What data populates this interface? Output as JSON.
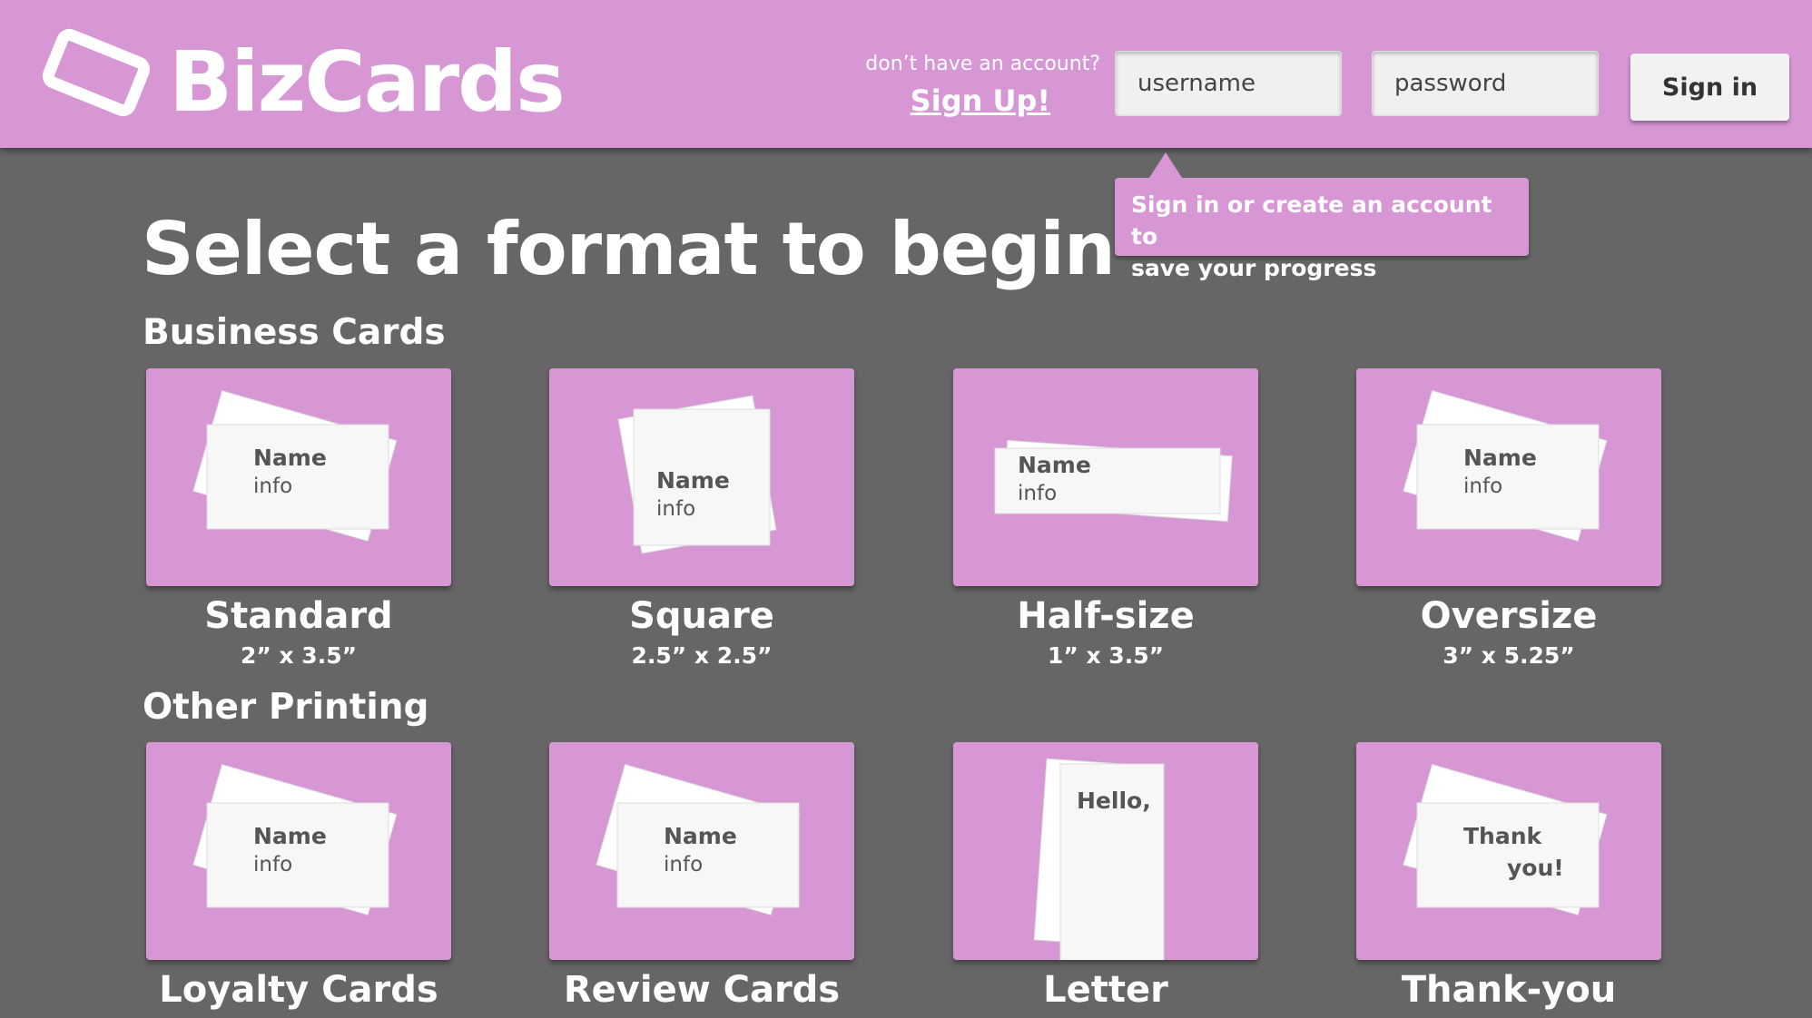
{
  "header": {
    "brand": "BizCards",
    "signup_prompt": "don’t have an account?",
    "signup_link": "Sign Up!",
    "username_placeholder": "username",
    "password_placeholder": "password",
    "signin_label": "Sign in"
  },
  "tooltip": {
    "line1": "Sign in or create an account to",
    "line2": "save your progress"
  },
  "page_title": "Select a format to begin",
  "sections": [
    {
      "heading": "Business Cards",
      "items": [
        {
          "label": "Standard",
          "size": "2” x 3.5”",
          "card_title": "Name",
          "card_sub": "info"
        },
        {
          "label": "Square",
          "size": "2.5” x 2.5”",
          "card_title": "Name",
          "card_sub": "info"
        },
        {
          "label": "Half-size",
          "size": "1” x 3.5”",
          "card_title": "Name",
          "card_sub": "info"
        },
        {
          "label": "Oversize",
          "size": "3” x 5.25”",
          "card_title": "Name",
          "card_sub": "info"
        }
      ]
    },
    {
      "heading": "Other Printing",
      "items": [
        {
          "label": "Loyalty Cards",
          "card_title": "Name",
          "card_sub": "info"
        },
        {
          "label": "Review Cards",
          "card_title": "Name",
          "card_sub": "info"
        },
        {
          "label": "Letter",
          "card_title": "Hello,"
        },
        {
          "label": "Thank-you",
          "card_title": "Thank",
          "card_sub": "you!"
        }
      ]
    }
  ],
  "colors": {
    "brand_pink": "#d797d5",
    "background": "#666666",
    "text_white": "#ffffff",
    "card_text": "#555555"
  },
  "icons": {
    "logo": "card-outline-icon"
  }
}
